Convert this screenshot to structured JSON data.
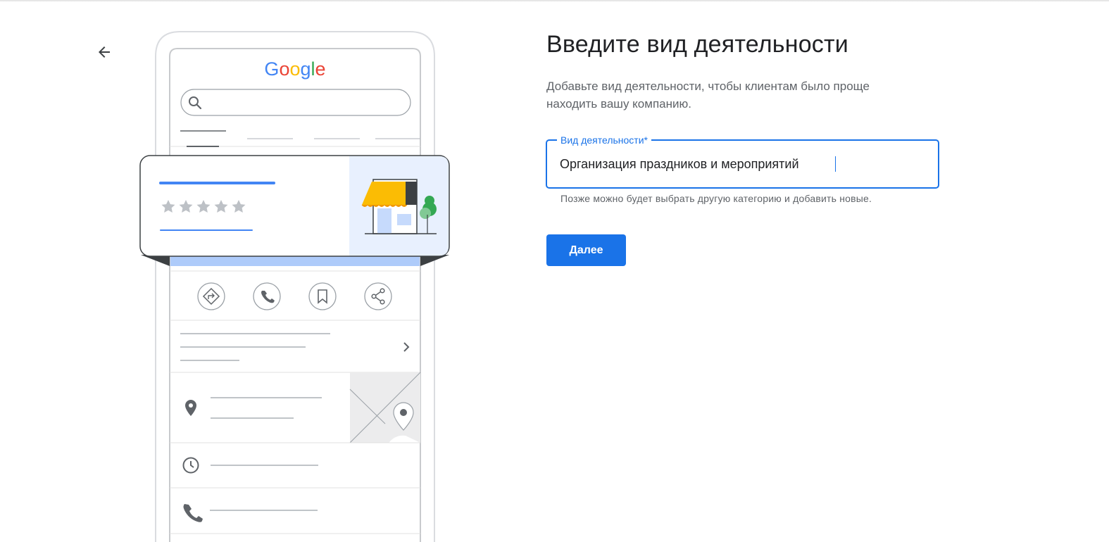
{
  "page": {
    "title": "Введите вид деятельности",
    "subtitle": "Добавьте вид деятельности, чтобы клиентам было проще находить вашу компанию."
  },
  "navigation": {
    "back_icon": "arrow-back-icon"
  },
  "category_field": {
    "label": "Вид деятельности*",
    "value": "Организация праздников и мероприятий",
    "helper_text": "Позже можно будет выбрать другую категорию и добавить новые."
  },
  "actions": {
    "next_label": "Далее"
  },
  "illustration": {
    "logo_text": "Google",
    "rating_stars": 5,
    "action_icons": [
      "directions-icon",
      "phone-icon",
      "bookmark-icon",
      "share-icon"
    ],
    "info_icons": [
      "location-pin-icon",
      "clock-icon",
      "phone-icon"
    ]
  },
  "colors": {
    "accent": "#1a73e8",
    "title_text": "#202124",
    "secondary_text": "#5f6368",
    "google_blue": "#4285F4",
    "google_red": "#EA4335",
    "google_yellow": "#FBBC05",
    "google_green": "#34A853",
    "awning_yellow": "#fbbc04",
    "card_tint": "#e8f0fe"
  }
}
